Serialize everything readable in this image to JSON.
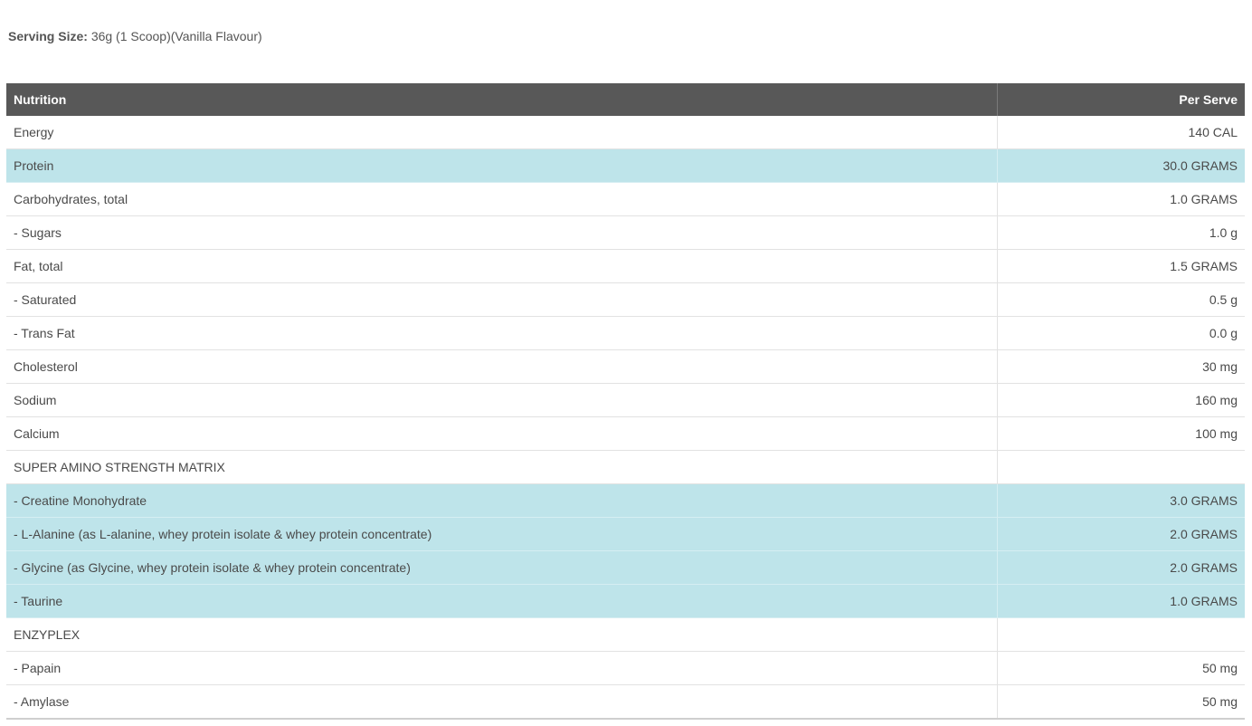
{
  "serving": {
    "label": "Serving Size:",
    "value": "36g (1 Scoop)(Vanilla Flavour)"
  },
  "table": {
    "headers": {
      "nutrition": "Nutrition",
      "per_serve": "Per Serve"
    },
    "highlight_color": "#bee4ea",
    "header_color": "#585858",
    "rows": [
      {
        "name": "Energy",
        "value": "140 CAL",
        "highlight": false
      },
      {
        "name": "Protein",
        "value": "30.0 GRAMS",
        "highlight": true
      },
      {
        "name": "Carbohydrates, total",
        "value": "1.0 GRAMS",
        "highlight": false
      },
      {
        "name": "- Sugars",
        "value": "1.0 g",
        "highlight": false
      },
      {
        "name": "Fat, total",
        "value": "1.5 GRAMS",
        "highlight": false
      },
      {
        "name": "- Saturated",
        "value": "0.5 g",
        "highlight": false
      },
      {
        "name": "- Trans Fat",
        "value": "0.0 g",
        "highlight": false
      },
      {
        "name": "Cholesterol",
        "value": "30 mg",
        "highlight": false
      },
      {
        "name": "Sodium",
        "value": "160 mg",
        "highlight": false
      },
      {
        "name": "Calcium",
        "value": "100 mg",
        "highlight": false
      },
      {
        "name": "SUPER AMINO STRENGTH MATRIX",
        "value": "",
        "highlight": false
      },
      {
        "name": "- Creatine Monohydrate",
        "value": "3.0 GRAMS",
        "highlight": true
      },
      {
        "name": "- L-Alanine (as L-alanine, whey protein isolate & whey protein concentrate)",
        "value": "2.0 GRAMS",
        "highlight": true
      },
      {
        "name": "- Glycine (as Glycine, whey protein isolate & whey protein concentrate)",
        "value": "2.0 GRAMS",
        "highlight": true
      },
      {
        "name": "- Taurine",
        "value": "1.0 GRAMS",
        "highlight": true
      },
      {
        "name": "ENZYPLEX",
        "value": "",
        "highlight": false
      },
      {
        "name": "- Papain",
        "value": "50 mg",
        "highlight": false
      },
      {
        "name": "- Amylase",
        "value": "50 mg",
        "highlight": false
      }
    ]
  }
}
